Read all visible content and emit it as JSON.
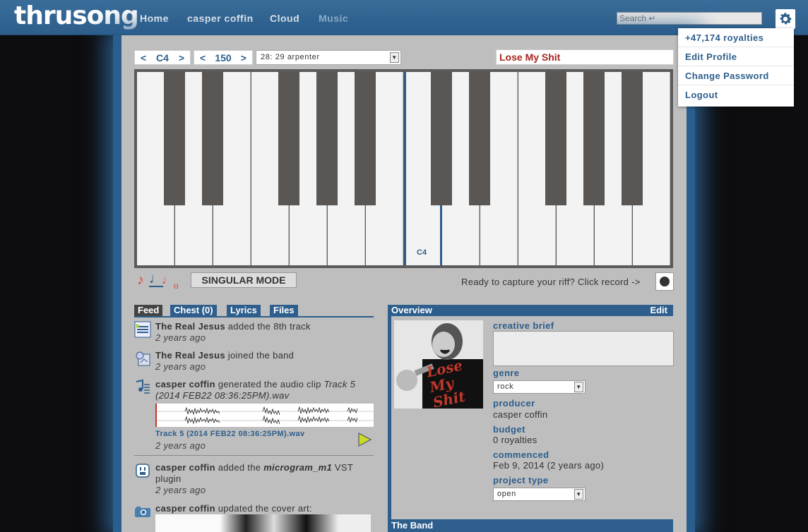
{
  "app": {
    "logo": "thrusong"
  },
  "nav": {
    "items": [
      {
        "label": "Home"
      },
      {
        "label": "casper coffin"
      },
      {
        "label": "Cloud"
      },
      {
        "label": "Music",
        "active": true
      }
    ]
  },
  "search": {
    "placeholder": "Search ↵"
  },
  "user_menu": {
    "items": [
      "+47,174 royalties",
      "Edit Profile",
      "Change Password",
      "Logout"
    ]
  },
  "composer": {
    "octave": "C4",
    "tempo": "150",
    "instrument": "28: 29 arpenter",
    "song_title": "Lose My Shit",
    "highlighted_key": "C4",
    "mode_button": "SINGULAR MODE",
    "record_prompt": "Ready to capture your riff? Click record ->",
    "note_durations": [
      "eighth-note-icon",
      "quarter-note-icon",
      "half-note-icon",
      "whole-note-icon"
    ]
  },
  "feed": {
    "tabs": [
      "Feed",
      "Chest (0)",
      "Lyrics",
      "Files"
    ],
    "items": [
      {
        "actor": "The Real Jesus",
        "action": " added the 8th track",
        "time": "2 years ago"
      },
      {
        "actor": "The Real Jesus",
        "action": " joined the band",
        "time": "2 years ago"
      },
      {
        "actor": "casper coffin",
        "action": " generated the audio clip ",
        "object": "Track 5 (2014 FEB22 08:36:25PM).wav",
        "clip_link": "Track 5 (2014 FEB22 08:36:25PM).wav",
        "time": "2 years ago"
      },
      {
        "actor": "casper coffin",
        "action": " added the ",
        "object": "microgram_m1",
        "action2": " VST plugin",
        "time": "2 years ago"
      },
      {
        "actor": "casper coffin",
        "action": " updated the cover art:"
      }
    ]
  },
  "overview": {
    "title": "Overview",
    "edit": "Edit",
    "cover_text": "Lose My Shit",
    "fields": {
      "creative_brief_label": "creative brief",
      "genre_label": "genre",
      "genre_value": "rock",
      "producer_label": "producer",
      "producer_value": "casper coffin",
      "budget_label": "budget",
      "budget_value": "0 royalties",
      "commenced_label": "commenced",
      "commenced_value": "Feb 9, 2014 (2 years ago)",
      "project_type_label": "project type",
      "project_type_value": "open"
    }
  },
  "band": {
    "title": "The Band"
  },
  "colors": {
    "primary": "#2d5e8c",
    "accent_red": "#a8261e",
    "note_red": "#d24c3c"
  }
}
